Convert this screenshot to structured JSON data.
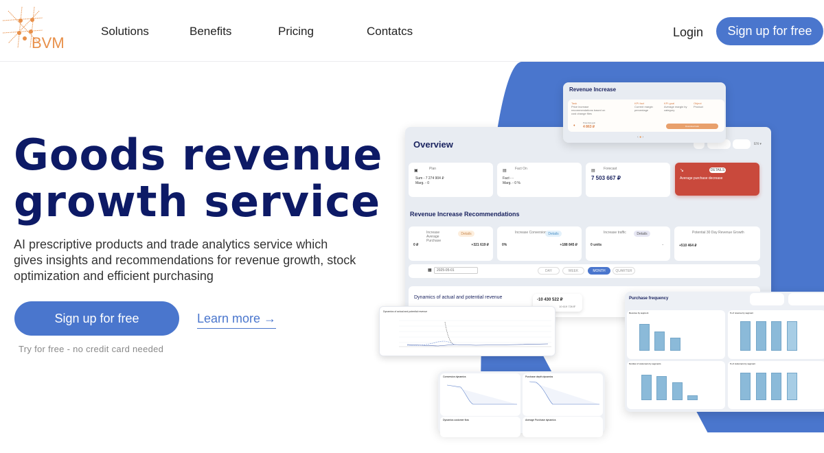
{
  "header": {
    "logo_text": "BVM",
    "nav": [
      "Solutions",
      "Benefits",
      "Pricing",
      "Contatcs"
    ],
    "login_label": "Login",
    "signup_label": "Sign up for free"
  },
  "hero": {
    "title_line1": "Goods revenue",
    "title_line2": "growth service",
    "subtitle": "AI prescriptive products and trade analytics service which gives insights and recommendations for revenue growth, stock optimization and efficient purchasing",
    "cta_label": "Sign up for free",
    "learn_more_label": "Learn more →",
    "note": "Try for free - no credit card needed"
  },
  "colors": {
    "accent": "#4a76cd",
    "title": "#0d1a66",
    "logo": "#e8904a",
    "alert": "#c9493c"
  },
  "preview": {
    "revenue_increase": {
      "title": "Revenue Increase",
      "task_label": "Task",
      "task_text": "Price increase recommendations based on cost change files",
      "kpi_fact_label": "KPI fact",
      "kpi_fact_text": "Current margin percentage",
      "kpi_goal_label": "KPI goal",
      "kpi_goal_text": "Average margin by category",
      "object_label": "Object",
      "object_text": "Product",
      "potential_label": "Potential gain",
      "potential_value": "4 863 ₽",
      "download_label": "Download task"
    },
    "overview": {
      "title": "Overview",
      "cards": [
        {
          "label": "Plan",
          "line1": "Sum - 7 274 904 ₽",
          "line2": "Marg. - 0"
        },
        {
          "label": "Fact On",
          "line1": "Fact - -",
          "line2": "Marg. - 0 %"
        },
        {
          "label": "Forecast",
          "value": "7 503 667 ₽"
        },
        {
          "label": "Average purchase decrease",
          "button": "DETAILS"
        }
      ]
    },
    "recommendations": {
      "title": "Revenue Increase Recommendations",
      "cards": [
        {
          "label": "Increase Average Purchase",
          "button": "Details",
          "left": "0 ₽",
          "right": "+321 619 ₽"
        },
        {
          "label": "Increase Conversion",
          "button": "Details",
          "left": "0%",
          "right": "+188 845 ₽"
        },
        {
          "label": "Increase traffic",
          "button": "Details",
          "left": "0 units",
          "right": "-"
        },
        {
          "label": "Potential 30 Day Revenue Growth",
          "left": "+510 464 ₽"
        }
      ],
      "date": "2025-05-01",
      "periods": [
        "DAY",
        "WEEK",
        "MONTH",
        "QUARTER"
      ],
      "active_period": "MONTH"
    },
    "dynamics": {
      "title": "Dynamics of actual and potential revenue",
      "value1": "-10 430 522 ₽",
      "value2": "10 619 726 ₽",
      "chart_title": "Dynamics of actual and potential revenue"
    },
    "purchase_frequency": {
      "title": "Purchase frequency",
      "charts": [
        "Revenue by segment",
        "% of revenue by segment",
        "Number of customers by segments",
        "% of customers by segment"
      ]
    },
    "mini_charts": [
      "Conversion dynamics",
      "Purchase depth dynamics",
      "Dynamics customer flow",
      "Average Purchase dynamics"
    ]
  }
}
